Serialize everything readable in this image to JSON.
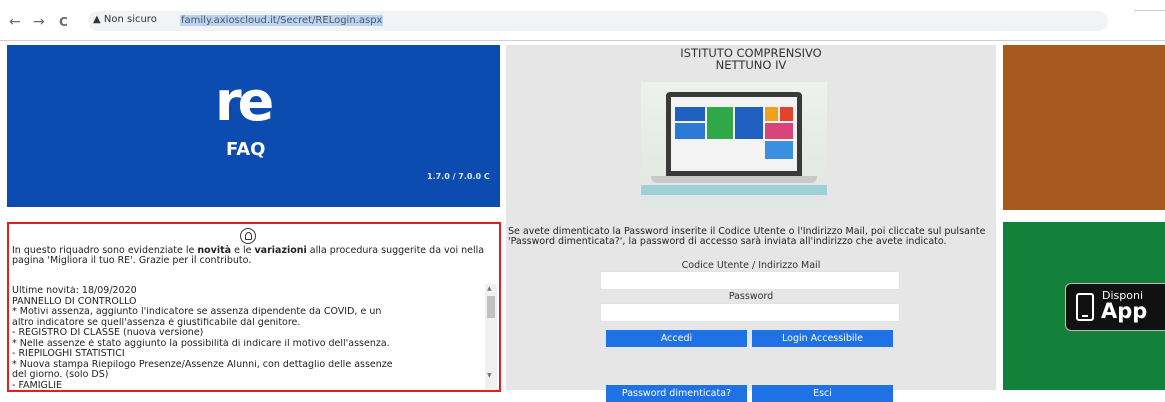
{
  "browser": {
    "back_icon": "←",
    "forward_icon": "→",
    "reload_icon": "C",
    "warning": "▲ Non sicuro",
    "url": "family.axioscloud.it/Secret/RELogin.aspx"
  },
  "faq_tile": {
    "logo": "re",
    "title": "FAQ",
    "version": "1.7.0 / 7.0.0 C"
  },
  "news": {
    "intro_before": "In questo riquadro sono evidenziate le ",
    "intro_bold1": "novità",
    "intro_mid": " e le ",
    "intro_bold2": "variazioni",
    "intro_after": " alla procedura suggerite da voi nella pagina 'Migliora il tuo RE'. Grazie per il contributo.",
    "lines": [
      "Ultime novità: 18/09/2020",
      "  PANNELLO DI CONTROLLO",
      "   * Motivi assenza, aggiunto l'indicatore se assenza dipendente da COVID, e un",
      "altro indicatore se quell'assenza è giustificabile dal genitore.",
      "- REGISTRO DI CLASSE (nuova versione)",
      "   * Nelle assenze è stato aggiunto la possibilità di indicare il motivo dell'assenza.",
      "- RIEPILOGHI STATISTICI",
      "   * Nuova stampa Riepilogo Presenze/Assenze Alunni, con dettaglio delle assenze",
      "del giorno. (solo DS)",
      "- FAMIGLIE"
    ]
  },
  "login": {
    "school_line1": "ISTITUTO COMPRENSIVO",
    "school_line2": "NETTUNO IV",
    "instructions": "Se avete dimenticato la Password inserite il Codice Utente o l'Indirizzo Mail, poi cliccate sul pulsante 'Password dimenticata?', la password di accesso sarà inviata all'indirizzo che avete indicato.",
    "user_label": "Codice Utente / Indirizzo Mail",
    "user_value": "",
    "password_label": "Password",
    "password_value": "",
    "login_button": "Accedi",
    "accessible_button": "Login Accessibile",
    "forgot_button": "Password dimenticata?",
    "exit_button": "Esci"
  },
  "app_badge": {
    "line1": "Disponi",
    "line2": "App"
  },
  "colors": {
    "faq_blue": "#0c4cb0",
    "button_blue": "#1f72e6",
    "news_border": "#e02020",
    "brown_tile": "#a85a1e",
    "green_tile": "#13813a"
  }
}
